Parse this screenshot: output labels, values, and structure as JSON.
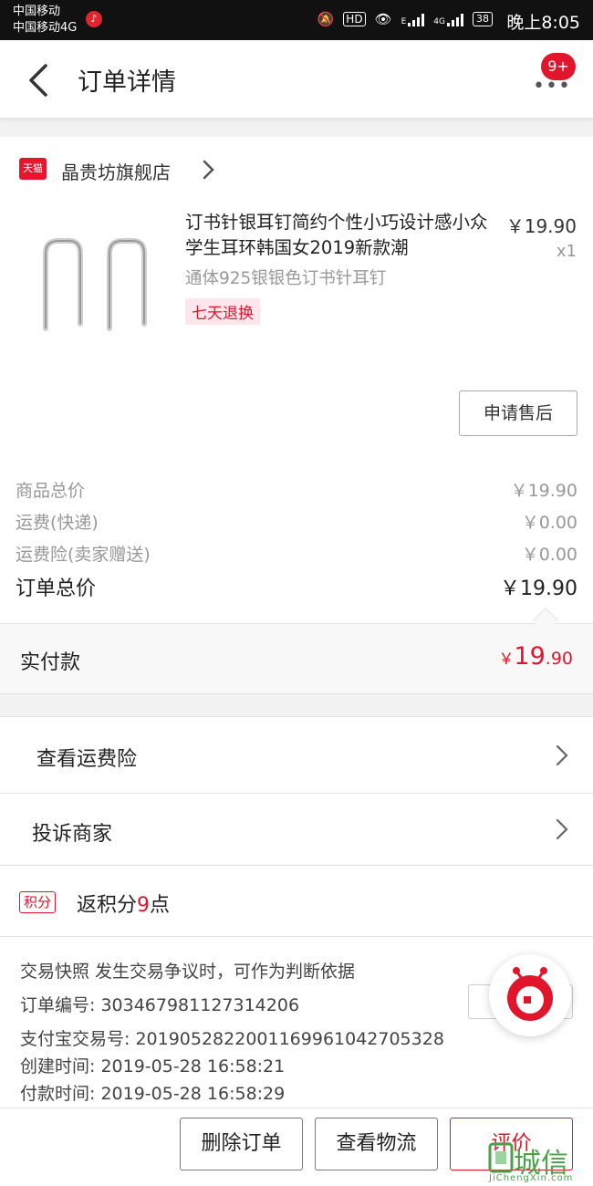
{
  "status_bar": {
    "carrier_line1": "中国移动",
    "carrier_line2": "中国移动4G",
    "hd": "HD",
    "net_e": "E",
    "net_4g": "4G",
    "battery": "38",
    "time": "晚上8:05"
  },
  "navbar": {
    "title": "订单详情",
    "badge": "9+"
  },
  "store": {
    "logo_text": "天猫",
    "name": "晶贵坊旗舰店"
  },
  "product": {
    "title": "订书针银耳钉简约个性小巧设计感小众学生耳环韩国女2019新款潮",
    "price": "￥19.90",
    "qty": "x1",
    "spec": "通体925银银色订书针耳钉",
    "tag": "七天退换",
    "after_sale_label": "申请售后"
  },
  "fees": [
    {
      "label": "商品总价",
      "value": "￥19.90"
    },
    {
      "label": "运费(快递)",
      "value": "￥0.00"
    },
    {
      "label": "运费险(卖家赠送)",
      "value": "￥0.00"
    }
  ],
  "order_total": {
    "label": "订单总价",
    "value": "￥19.90"
  },
  "paid": {
    "label": "实付款",
    "currency": "￥",
    "integer": "19",
    "decimal": ".90"
  },
  "rows": {
    "shipping_insurance": "查看运费险",
    "complain": "投诉商家"
  },
  "points": {
    "tag": "积分",
    "prefix": "返积分",
    "num": "9",
    "suffix": "点"
  },
  "info": {
    "snapshot": "交易快照  发生交易争议时，可作为判断依据",
    "order_no": "订单编号: 303467981127314206",
    "alipay_no": "支付宝交易号: 2019052822001169961042705328",
    "created": "创建时间: 2019-05-28 16:58:21",
    "paid_time": "付款时间: 2019-05-28 16:58:29"
  },
  "bottom_bar": {
    "delete": "删除订单",
    "logistics": "查看物流",
    "review": "评价"
  },
  "watermark": {
    "text": "城信",
    "sub": "JiChengXin.com"
  },
  "colors": {
    "accent": "#e1152c",
    "background": "#f2f2f2",
    "muted": "#999999"
  }
}
